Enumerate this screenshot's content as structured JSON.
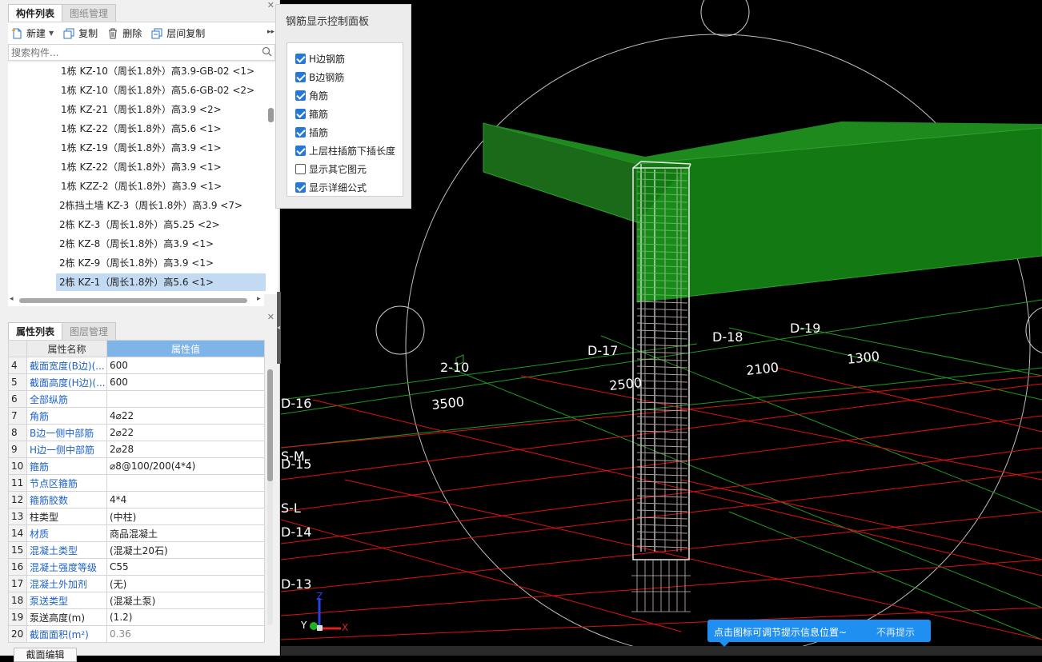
{
  "component_panel": {
    "tabs": [
      "构件列表",
      "图纸管理"
    ],
    "toolbar": {
      "new": "新建",
      "copy": "复制",
      "delete": "删除",
      "floor_copy": "层间复制"
    },
    "search_placeholder": "搜索构件...",
    "items": [
      "1栋 KZ-10（周长1.8外）高3.9-GB-02 <1>",
      "1栋 KZ-10（周长1.8外）高5.6-GB-02 <2>",
      "1栋 KZ-21（周长1.8外）高3.9 <2>",
      "1栋 KZ-22（周长1.8外）高5.6 <1>",
      "1栋 KZ-19（周长1.8外）高3.9 <1>",
      "1栋 KZ-22（周长1.8外）高3.9 <1>",
      "1栋 KZZ-2（周长1.8外）高3.9 <1>",
      "2栋挡土墙 KZ-3（周长1.8外）高3.9 <7>",
      "2栋 KZ-3（周长1.8外）高5.25 <2>",
      "2栋 KZ-8（周长1.8外）高3.9 <1>",
      "2栋 KZ-9（周长1.8外）高3.9 <1>",
      "2栋 KZ-1（周长1.8外）高5.6 <1>"
    ],
    "selected_index": 11
  },
  "property_panel": {
    "tabs": [
      "属性列表",
      "图层管理"
    ],
    "header": {
      "name": "属性名称",
      "value": "属性值"
    },
    "rows": [
      {
        "num": "4",
        "name": "截面宽度(B边)(...",
        "value": "600",
        "blue": true
      },
      {
        "num": "5",
        "name": "截面高度(H边)(...",
        "value": "600",
        "blue": true
      },
      {
        "num": "6",
        "name": "全部纵筋",
        "value": "",
        "blue": true
      },
      {
        "num": "7",
        "name": "角筋",
        "value": "4⌀22",
        "blue": true
      },
      {
        "num": "8",
        "name": "B边一侧中部筋",
        "value": "2⌀22",
        "blue": true
      },
      {
        "num": "9",
        "name": "H边一侧中部筋",
        "value": "2⌀28",
        "blue": true
      },
      {
        "num": "10",
        "name": "箍筋",
        "value": "⌀8@100/200(4*4)",
        "blue": true
      },
      {
        "num": "11",
        "name": "节点区箍筋",
        "value": "",
        "blue": true
      },
      {
        "num": "12",
        "name": "箍筋胶数",
        "value": "4*4",
        "blue": true
      },
      {
        "num": "13",
        "name": "柱类型",
        "value": "(中柱)",
        "blue": false
      },
      {
        "num": "14",
        "name": "材质",
        "value": "商品混凝土",
        "blue": true
      },
      {
        "num": "15",
        "name": "混凝土类型",
        "value": "(混凝土20石)",
        "blue": true
      },
      {
        "num": "16",
        "name": "混凝土强度等级",
        "value": "C55",
        "blue": true
      },
      {
        "num": "17",
        "name": "混凝土外加剂",
        "value": "(无)",
        "blue": true
      },
      {
        "num": "18",
        "name": "泵送类型",
        "value": "(混凝土泵)",
        "blue": true
      },
      {
        "num": "19",
        "name": "泵送高度(m)",
        "value": "(1.2)",
        "blue": false
      },
      {
        "num": "20",
        "name": "截面面积(m²)",
        "value": "0.36",
        "blue": true,
        "gray_value": true
      }
    ],
    "bottom_button": "截面编辑"
  },
  "rebar_panel": {
    "title": "钢筋显示控制面板",
    "options": [
      {
        "label": "H边钢筋",
        "checked": true
      },
      {
        "label": "B边钢筋",
        "checked": true
      },
      {
        "label": "角筋",
        "checked": true
      },
      {
        "label": "箍筋",
        "checked": true
      },
      {
        "label": "插筋",
        "checked": true
      },
      {
        "label": "上层柱插筋下插长度",
        "checked": true
      },
      {
        "label": "显示其它图元",
        "checked": false
      },
      {
        "label": "显示详细公式",
        "checked": true
      }
    ]
  },
  "viewport": {
    "axis_labels": [
      "2-10",
      "D-17",
      "D-18",
      "D-19",
      "D-16",
      "S-M",
      "D-15",
      "S-L",
      "D-14",
      "D-13"
    ],
    "dimensions": [
      "3500",
      "2500",
      "2100",
      "1300"
    ],
    "axis_names": {
      "x": "X",
      "y": "Y",
      "z": "Z"
    }
  },
  "tooltip": {
    "message": "点击图标可调节提示信息位置~",
    "dismiss": "不再提示"
  }
}
